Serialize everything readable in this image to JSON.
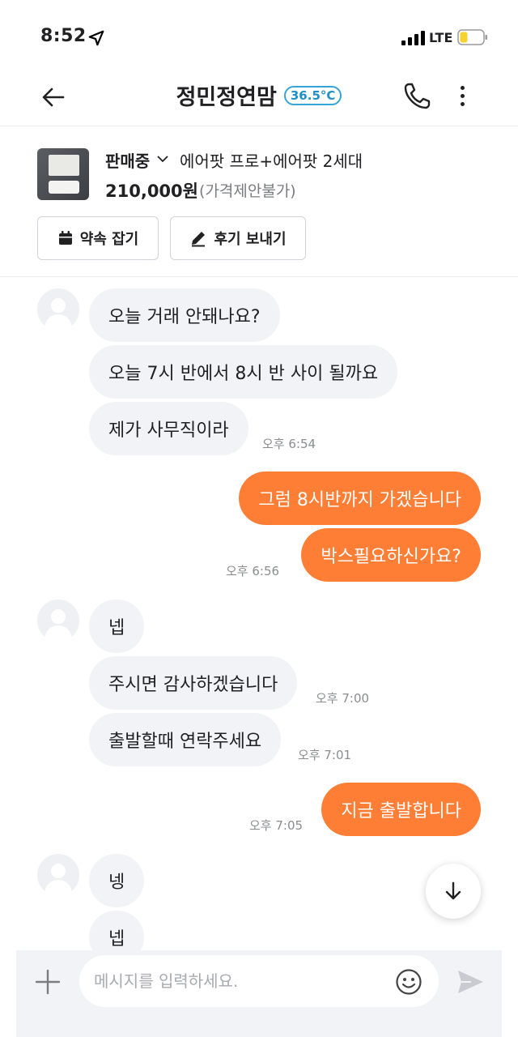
{
  "status_bar": {
    "time": "8:52",
    "network": "LTE"
  },
  "header": {
    "title": "정민정연맘",
    "temperature": "36.5°C",
    "icons": [
      "back-arrow-icon",
      "phone-icon",
      "more-vert-icon"
    ]
  },
  "product": {
    "status": "판매중",
    "name": "에어팟 프로+에어팟 2세대",
    "price": "210,000원",
    "negotiation": "(가격제안불가)",
    "appoint_label": "약속 잡기",
    "review_label": "후기 보내기"
  },
  "messages": {
    "m1": "오늘 거래 안돼나요?",
    "m2": "오늘 7시 반에서 8시 반 사이 될까요",
    "m3": "제가 사무직이라",
    "t3": "오후 6:54",
    "m4": "그럼 8시반까지 가겠습니다",
    "m5": "박스필요하신가요?",
    "t5": "오후 6:56",
    "m6": "넵",
    "m7": "주시면 감사하겠습니다",
    "t7": "오후 7:00",
    "m8": "출발할때 연락주세요",
    "t8": "오후 7:01",
    "m9": "지금 출발합니다",
    "t9": "오후 7:05",
    "m10": "넹",
    "m11": "넵"
  },
  "composer": {
    "placeholder": "메시지를 입력하세요."
  },
  "colors": {
    "accent": "#ff7e36",
    "received_bubble": "#f2f3f6",
    "temperature": "#1f8fc9"
  }
}
